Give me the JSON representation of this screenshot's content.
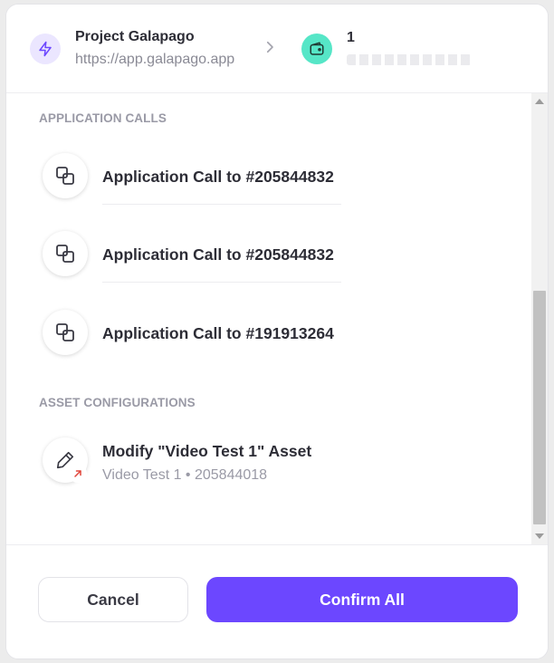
{
  "header": {
    "dapp_name": "Project Galapago",
    "dapp_url": "https://app.galapago.app",
    "account_number": "1"
  },
  "sections": {
    "application_calls_title": "APPLICATION CALLS",
    "asset_configurations_title": "ASSET CONFIGURATIONS"
  },
  "application_calls": [
    {
      "label": "Application Call to #205844832"
    },
    {
      "label": "Application Call to #205844832"
    },
    {
      "label": "Application Call to #191913264"
    }
  ],
  "asset_configurations": [
    {
      "label": "Modify \"Video Test 1\" Asset",
      "subtitle": "Video Test 1 • 205844018"
    }
  ],
  "footer": {
    "cancel_label": "Cancel",
    "confirm_label": "Confirm All"
  },
  "colors": {
    "accent": "#6c47ff",
    "dapp_icon_bg": "#ebe6ff",
    "wallet_icon_bg": "#56e6c7",
    "modify_arrow": "#e0453a"
  }
}
